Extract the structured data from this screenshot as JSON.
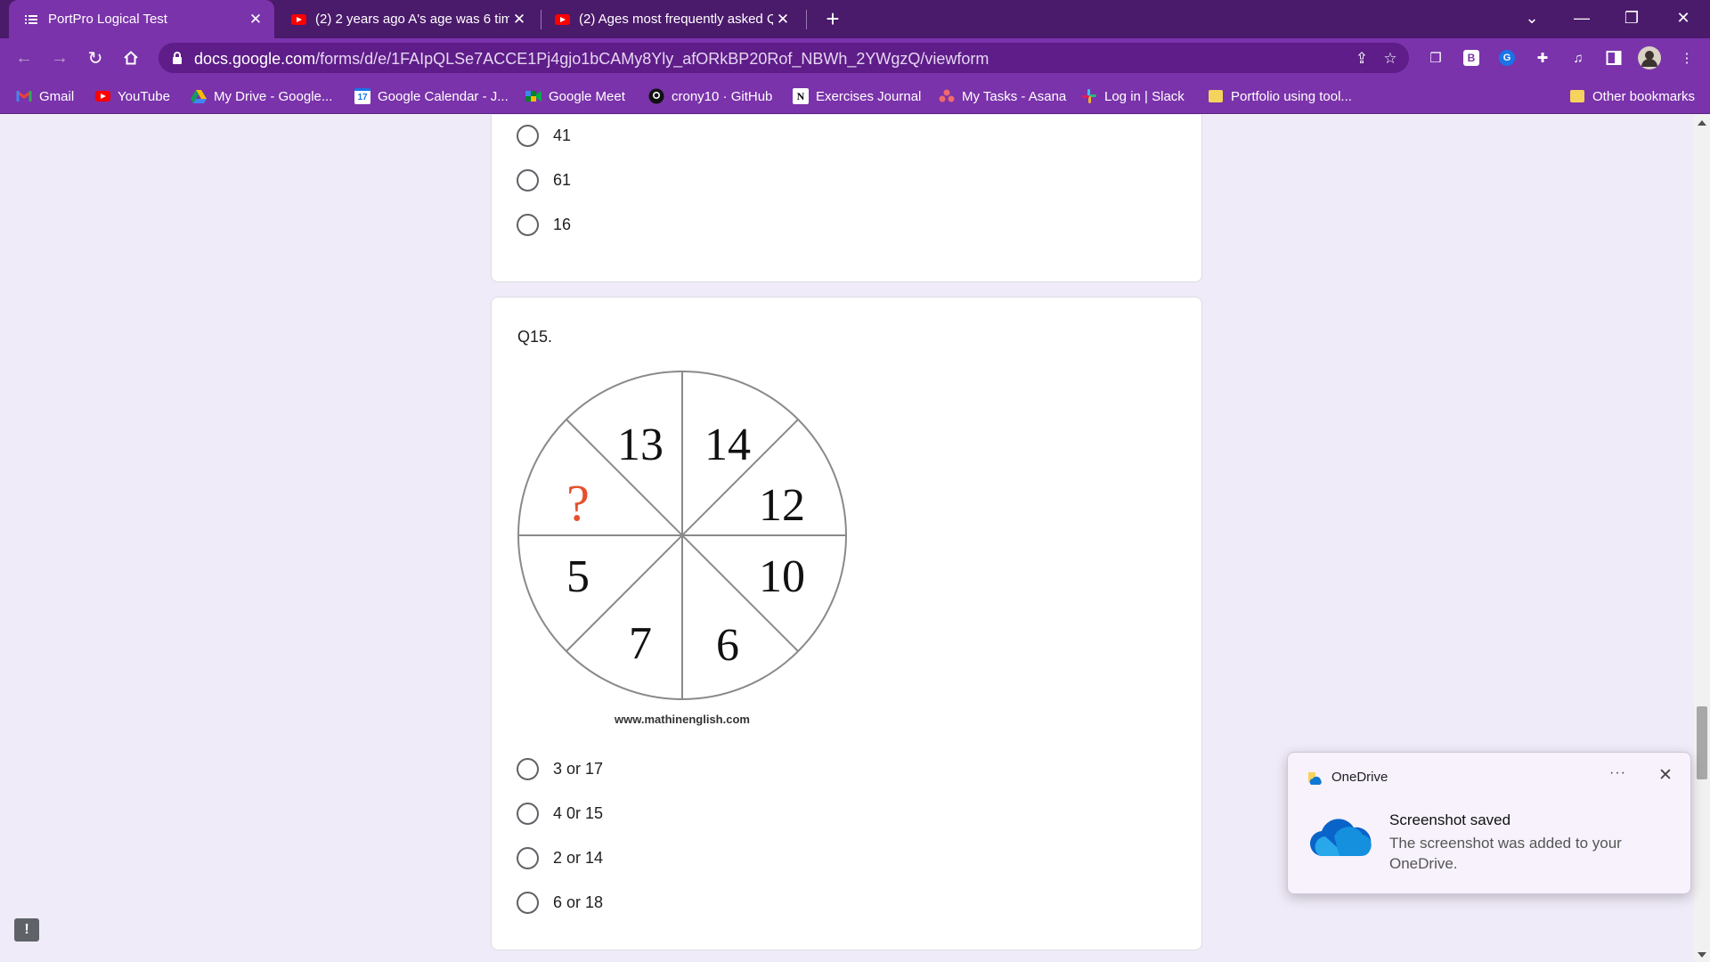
{
  "browser": {
    "tabs": [
      {
        "title": "PortPro Logical Test",
        "active": true
      },
      {
        "title": "(2) 2 years ago A's age was 6 tim",
        "active": false
      },
      {
        "title": "(2) Ages most frequently asked Q",
        "active": false
      }
    ],
    "new_tab": "+",
    "url_host": "docs.google.com",
    "url_path": "/forms/d/e/1FAIpQLSe7ACCE1Pj4gjo1bCAMy8Yly_afORkBP20Rof_NBWh_2YWgzQ/viewform",
    "bookmarks": [
      {
        "label": "Gmail"
      },
      {
        "label": "YouTube"
      },
      {
        "label": "My Drive - Google..."
      },
      {
        "label": "Google Calendar - J..."
      },
      {
        "label": "Google Meet"
      },
      {
        "label": "crony10 · GitHub"
      },
      {
        "label": "Exercises Journal"
      },
      {
        "label": "My Tasks - Asana"
      },
      {
        "label": "Log in | Slack"
      },
      {
        "label": "Portfolio using tool..."
      }
    ],
    "other_bookmarks": "Other bookmarks"
  },
  "form": {
    "prev_question_options": [
      "41",
      "61",
      "16"
    ],
    "question": {
      "title": "Q15.",
      "puzzle": {
        "segments": [
          "13",
          "14",
          "12",
          "10",
          "6",
          "7",
          "5",
          "?"
        ],
        "credit": "www.mathinenglish.com"
      },
      "options": [
        "3 or 17",
        "4 0r 15",
        "2 or 14",
        "6 or 18"
      ]
    }
  },
  "notification": {
    "app": "OneDrive",
    "more": "···",
    "title": "Screenshot saved",
    "body": "The screenshot was added to your OneDrive."
  },
  "colors": {
    "chrome_dark": "#4a1a6b",
    "chrome": "#7a33aa",
    "page_bg": "#f0ebf8",
    "question_mark": "#e4512c"
  }
}
